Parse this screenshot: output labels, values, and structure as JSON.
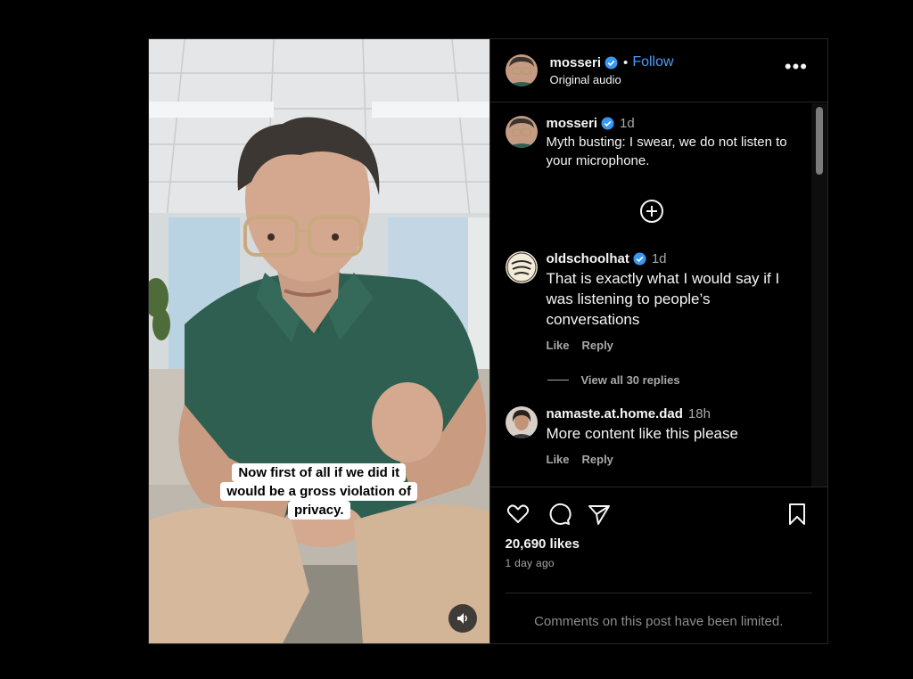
{
  "video": {
    "caption_lines": [
      "Now first of all if we did it",
      "would be a gross violation of",
      "privacy."
    ],
    "mute_icon": "speaker-icon"
  },
  "header": {
    "username": "mosseri",
    "verified_icon": "verified-badge-icon",
    "separator": "•",
    "follow_label": "Follow",
    "audio_label": "Original audio",
    "more_label": "•••"
  },
  "caption_comment": {
    "username": "mosseri",
    "time": "1d",
    "text": "Myth busting: I swear, we do not listen to your microphone."
  },
  "comments": [
    {
      "username": "oldschoolhat",
      "verified": true,
      "time": "1d",
      "text": "That is exactly what I would say if I was listening to people’s conversations",
      "like_label": "Like",
      "reply_label": "Reply",
      "view_replies": "View all 30 replies"
    },
    {
      "username": "namaste.at.home.dad",
      "verified": false,
      "time": "18h",
      "text": "More content like this please",
      "like_label": "Like",
      "reply_label": "Reply"
    }
  ],
  "stats": {
    "likes": "20,690 likes",
    "date": "1 day ago"
  },
  "footer": {
    "limited_notice": "Comments on this post have been limited."
  },
  "colors": {
    "background": "#000000",
    "follow": "#4a9df8",
    "verified": "#3897f0",
    "muted_text": "#a8a8a8",
    "border": "#262626"
  }
}
